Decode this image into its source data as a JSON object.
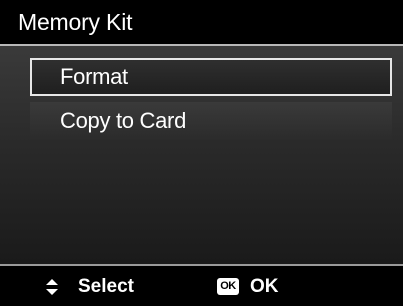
{
  "header": {
    "title": "Memory Kit"
  },
  "menu": {
    "items": [
      {
        "label": "Format",
        "selected": true
      },
      {
        "label": "Copy to Card",
        "selected": false
      }
    ]
  },
  "footer": {
    "select_icon": "up-down-arrows-icon",
    "select_label": "Select",
    "ok_icon_text": "OK",
    "ok_label": "OK"
  },
  "colors": {
    "background": "#000000",
    "text": "#ffffff",
    "highlight_border": "#e6e6e6",
    "divider": "#b8b8b8"
  }
}
